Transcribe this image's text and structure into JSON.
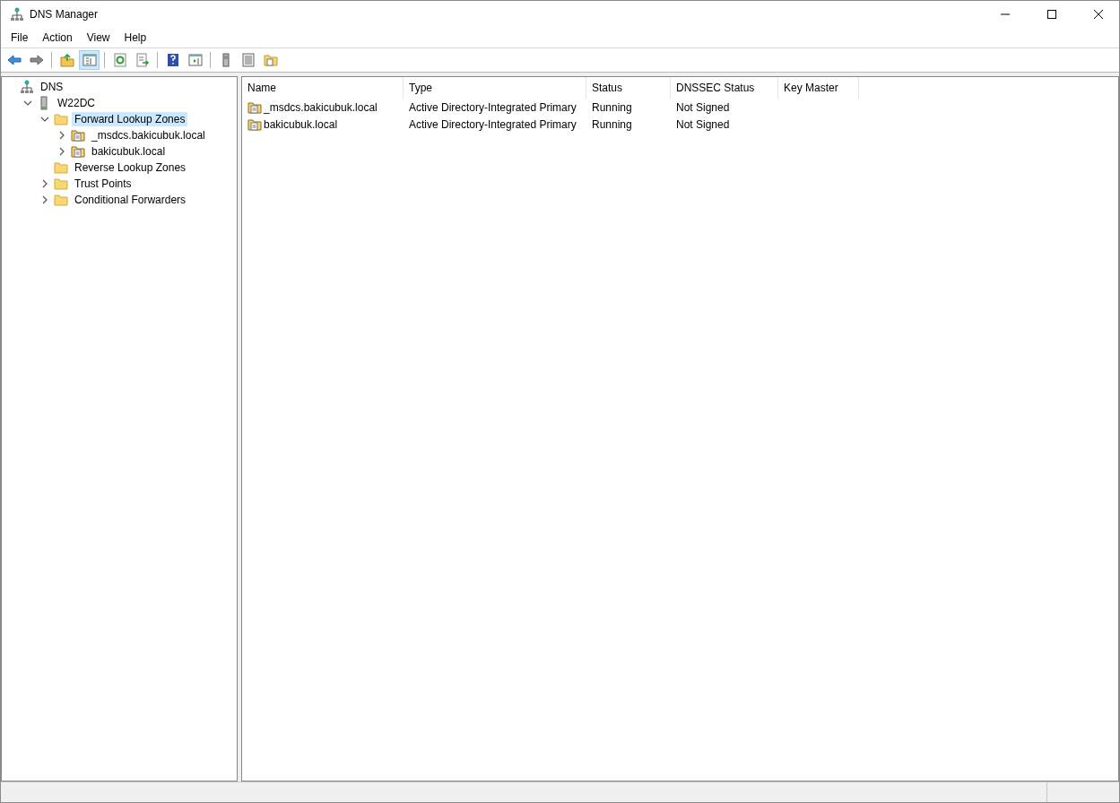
{
  "window": {
    "title": "DNS Manager"
  },
  "menu": [
    "File",
    "Action",
    "View",
    "Help"
  ],
  "toolbar": [
    {
      "kind": "back",
      "pressed": false
    },
    {
      "kind": "forward",
      "pressed": false
    },
    {
      "kind": "sep"
    },
    {
      "kind": "up",
      "pressed": false
    },
    {
      "kind": "tree",
      "pressed": true
    },
    {
      "kind": "sep"
    },
    {
      "kind": "refresh",
      "pressed": false
    },
    {
      "kind": "export",
      "pressed": false
    },
    {
      "kind": "sep"
    },
    {
      "kind": "help",
      "pressed": false
    },
    {
      "kind": "panel",
      "pressed": false
    },
    {
      "kind": "sep"
    },
    {
      "kind": "server",
      "pressed": false
    },
    {
      "kind": "list",
      "pressed": false
    },
    {
      "kind": "zone",
      "pressed": false
    }
  ],
  "tree": [
    {
      "label": "DNS",
      "kind": "root",
      "selected": false,
      "children": [
        {
          "label": "W22DC",
          "kind": "server",
          "expanded": true,
          "selected": false,
          "children": [
            {
              "label": "Forward Lookup Zones",
              "kind": "folder",
              "expanded": true,
              "selected": true,
              "children": [
                {
                  "label": "_msdcs.bakicubuk.local",
                  "kind": "zone",
                  "expanded": false,
                  "selected": false
                },
                {
                  "label": "bakicubuk.local",
                  "kind": "zone",
                  "expanded": false,
                  "selected": false
                }
              ]
            },
            {
              "label": "Reverse Lookup Zones",
              "kind": "folder",
              "selected": false
            },
            {
              "label": "Trust Points",
              "kind": "folder",
              "expanded": false,
              "selected": false
            },
            {
              "label": "Conditional Forwarders",
              "kind": "folder",
              "expanded": false,
              "selected": false
            }
          ]
        }
      ]
    }
  ],
  "table": {
    "columns": [
      "Name",
      "Type",
      "Status",
      "DNSSEC Status",
      "Key Master"
    ],
    "rows": [
      [
        "_msdcs.bakicubuk.local",
        "Active Directory-Integrated Primary",
        "Running",
        "Not Signed",
        ""
      ],
      [
        "bakicubuk.local",
        "Active Directory-Integrated Primary",
        "Running",
        "Not Signed",
        ""
      ]
    ]
  }
}
